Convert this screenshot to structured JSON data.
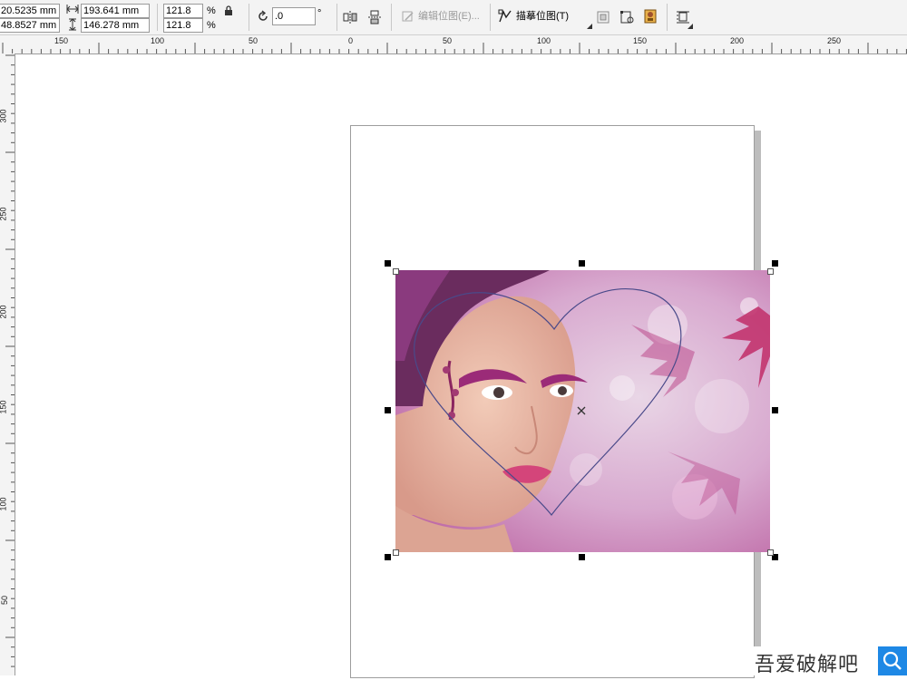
{
  "toolbar": {
    "pos_x": "20.5235 mm",
    "pos_y": "48.8527 mm",
    "width_mm": "193.641 mm",
    "height_mm": "146.278 mm",
    "scale_x": "121.8",
    "scale_y": "121.8",
    "percent": "%",
    "rotation": ".0",
    "degree": "°",
    "edit_bitmap_label": "编辑位图(E)...",
    "trace_bitmap_label": "描摹位图(T)"
  },
  "rulers": {
    "horizontal_ticks": [
      "150",
      "100",
      "50",
      "0",
      "50",
      "100",
      "150",
      "200",
      "250"
    ],
    "vertical_ticks": [
      "300",
      "250",
      "200",
      "150",
      "100",
      "50"
    ]
  },
  "watermark": {
    "text": "吾爱破解吧"
  },
  "colors": {
    "selection_handle": "#000000",
    "heart_outline": "#4a4a8a",
    "page_border": "#9d9d9d",
    "search_button": "#1e88e5"
  }
}
